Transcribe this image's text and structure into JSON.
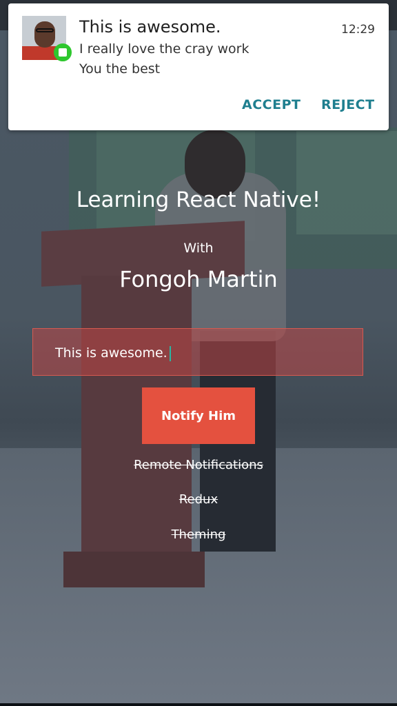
{
  "notification": {
    "title": "This is awesome.",
    "time": "12:29",
    "lines": [
      "I really love the cray work",
      "You the best"
    ],
    "actions": {
      "accept": "ACCEPT",
      "reject": "REJECT"
    },
    "avatar_icon": "user-avatar",
    "badge_icon": "app-badge-icon",
    "badge_color": "#2ec72e",
    "action_color": "#1f7f8f"
  },
  "main": {
    "title": "Learning React Native!",
    "with_label": "With",
    "author": "Fongoh Martin",
    "input_value": "This is awesome.",
    "notify_button": "Notify Him",
    "button_color": "#e4513f",
    "todos": [
      "Remote Notifications",
      "Redux",
      "Theming"
    ]
  }
}
